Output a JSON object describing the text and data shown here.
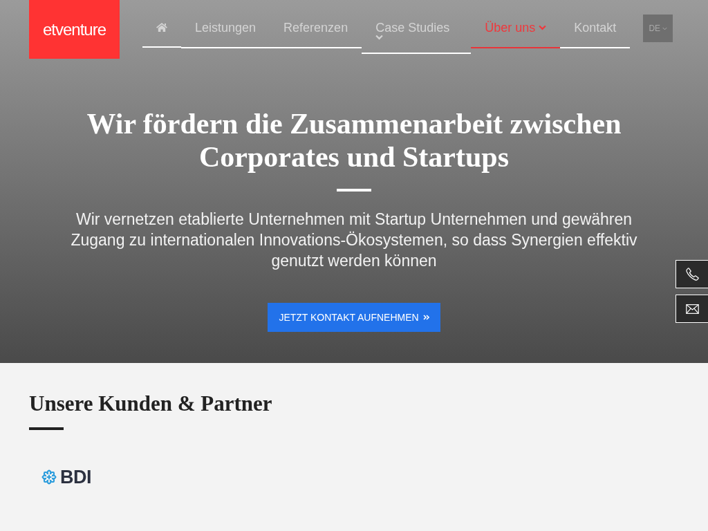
{
  "header": {
    "logo": "etventure",
    "nav": [
      {
        "kind": "home",
        "selected": false
      },
      {
        "kind": "link",
        "label": "Leistungen",
        "dropdown": false,
        "selected": false
      },
      {
        "kind": "link",
        "label": "Referenzen",
        "dropdown": false,
        "selected": false
      },
      {
        "kind": "link",
        "label": "Case Studies",
        "dropdown": true,
        "selected": false
      },
      {
        "kind": "link",
        "label": "Über uns",
        "dropdown": true,
        "selected": true
      },
      {
        "kind": "link",
        "label": "Kontakt",
        "dropdown": false,
        "selected": false
      }
    ],
    "language": {
      "label": "DE"
    }
  },
  "hero": {
    "title": "Wir fördern die Zusammenarbeit zwischen Corporates und Startups",
    "text": "Wir vernetzen etablierte Unternehmen mit Startup Unternehmen und gewähren Zugang zu internationalen Innovations-Ökosystemen, so dass Synergien effektiv genutzt werden können",
    "button": "JETZT KONTAKT AUFNEHMEN"
  },
  "side_buttons": [
    {
      "kind": "phone"
    },
    {
      "kind": "mail"
    }
  ],
  "partners": {
    "title": "Unsere Kunden & Partner",
    "logos": [
      {
        "name": "BDI"
      }
    ]
  }
}
